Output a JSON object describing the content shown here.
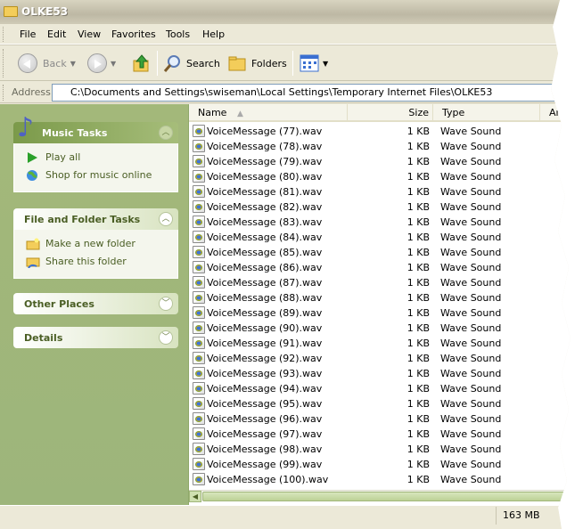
{
  "window": {
    "title": "OLKE53"
  },
  "menu": [
    "File",
    "Edit",
    "View",
    "Favorites",
    "Tools",
    "Help"
  ],
  "toolbar": {
    "back": "Back",
    "search": "Search",
    "folders": "Folders"
  },
  "address": {
    "label": "Address",
    "path": "C:\\Documents and Settings\\swiseman\\Local Settings\\Temporary Internet Files\\OLKE53"
  },
  "panels": {
    "music": {
      "title": "Music Tasks",
      "items": [
        "Play all",
        "Shop for music online"
      ]
    },
    "fileFolder": {
      "title": "File and Folder Tasks",
      "items": [
        "Make a new folder",
        "Share this folder"
      ]
    },
    "other": {
      "title": "Other Places"
    },
    "details": {
      "title": "Details"
    }
  },
  "columns": [
    "Name",
    "Size",
    "Type",
    "Artis"
  ],
  "files": [
    {
      "name": "VoiceMessage (77).wav",
      "size": "1 KB",
      "type": "Wave Sound"
    },
    {
      "name": "VoiceMessage (78).wav",
      "size": "1 KB",
      "type": "Wave Sound"
    },
    {
      "name": "VoiceMessage (79).wav",
      "size": "1 KB",
      "type": "Wave Sound"
    },
    {
      "name": "VoiceMessage (80).wav",
      "size": "1 KB",
      "type": "Wave Sound"
    },
    {
      "name": "VoiceMessage (81).wav",
      "size": "1 KB",
      "type": "Wave Sound"
    },
    {
      "name": "VoiceMessage (82).wav",
      "size": "1 KB",
      "type": "Wave Sound"
    },
    {
      "name": "VoiceMessage (83).wav",
      "size": "1 KB",
      "type": "Wave Sound"
    },
    {
      "name": "VoiceMessage (84).wav",
      "size": "1 KB",
      "type": "Wave Sound"
    },
    {
      "name": "VoiceMessage (85).wav",
      "size": "1 KB",
      "type": "Wave Sound"
    },
    {
      "name": "VoiceMessage (86).wav",
      "size": "1 KB",
      "type": "Wave Sound"
    },
    {
      "name": "VoiceMessage (87).wav",
      "size": "1 KB",
      "type": "Wave Sound"
    },
    {
      "name": "VoiceMessage (88).wav",
      "size": "1 KB",
      "type": "Wave Sound"
    },
    {
      "name": "VoiceMessage (89).wav",
      "size": "1 KB",
      "type": "Wave Sound"
    },
    {
      "name": "VoiceMessage (90).wav",
      "size": "1 KB",
      "type": "Wave Sound"
    },
    {
      "name": "VoiceMessage (91).wav",
      "size": "1 KB",
      "type": "Wave Sound"
    },
    {
      "name": "VoiceMessage (92).wav",
      "size": "1 KB",
      "type": "Wave Sound"
    },
    {
      "name": "VoiceMessage (93).wav",
      "size": "1 KB",
      "type": "Wave Sound"
    },
    {
      "name": "VoiceMessage (94).wav",
      "size": "1 KB",
      "type": "Wave Sound"
    },
    {
      "name": "VoiceMessage (95).wav",
      "size": "1 KB",
      "type": "Wave Sound"
    },
    {
      "name": "VoiceMessage (96).wav",
      "size": "1 KB",
      "type": "Wave Sound"
    },
    {
      "name": "VoiceMessage (97).wav",
      "size": "1 KB",
      "type": "Wave Sound"
    },
    {
      "name": "VoiceMessage (98).wav",
      "size": "1 KB",
      "type": "Wave Sound"
    },
    {
      "name": "VoiceMessage (99).wav",
      "size": "1 KB",
      "type": "Wave Sound"
    },
    {
      "name": "VoiceMessage (100).wav",
      "size": "1 KB",
      "type": "Wave Sound"
    }
  ],
  "status": {
    "size": "163 MB"
  },
  "colors": {
    "taskPane": "#a3b87a",
    "accent": "#4a5e24"
  }
}
